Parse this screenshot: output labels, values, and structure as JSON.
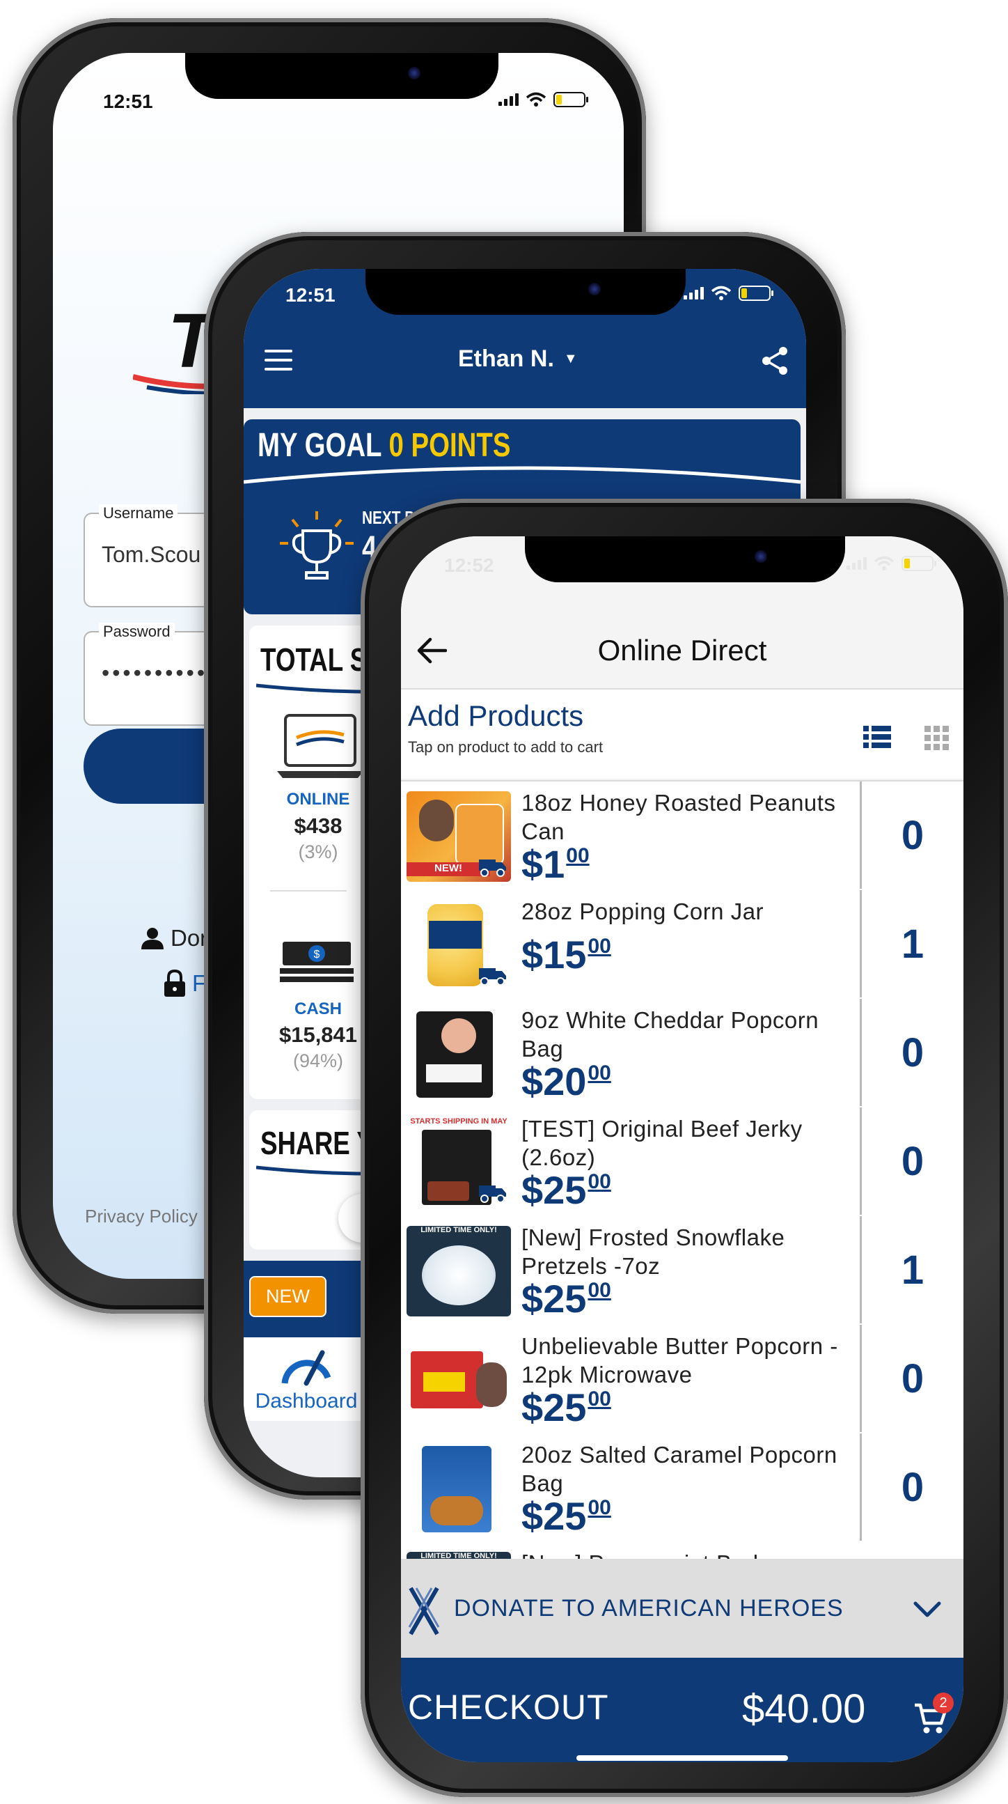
{
  "login": {
    "status_time": "12:51",
    "logo_text": "TR",
    "username_label": "Username",
    "username_value": "Tom.Scou",
    "password_label": "Password",
    "password_value": "••••••••••",
    "donate_link": "Don",
    "forgot_link": "Fo",
    "privacy_link": "Privacy Policy"
  },
  "dashboard": {
    "status_time": "12:51",
    "scout_name": "Ethan N.",
    "goal_title": "MY GOAL",
    "goal_points": "0 POINTS",
    "next_prize_label": "NEXT PR",
    "next_prize_value": "4",
    "total_sales_title": "TOTAL SA",
    "online_label": "ONLINE",
    "online_amount": "$438",
    "online_pct": "(3%)",
    "cash_label": "CASH",
    "cash_amount": "$15,841",
    "cash_pct": "(94%)",
    "share_title": "SHARE YO",
    "new_badge": "NEW",
    "nav_dashboard": "Dashboard"
  },
  "online_direct": {
    "status_time": "12:52",
    "title": "Online Direct",
    "add_products_title": "Add Products",
    "add_products_hint": "Tap on product to add to cart",
    "products": [
      {
        "name": "18oz Honey Roasted Peanuts Can",
        "price_dollars": "$1",
        "price_cents": "00",
        "qty": "0",
        "shipping": true,
        "img_badge": "NEW!"
      },
      {
        "name": "28oz Popping Corn Jar",
        "price_dollars": "$15",
        "price_cents": "00",
        "qty": "1",
        "shipping": true,
        "img_badge": ""
      },
      {
        "name": " 9oz White Cheddar Popcorn Bag",
        "price_dollars": "$20",
        "price_cents": "00",
        "qty": "0",
        "shipping": false,
        "img_badge": ""
      },
      {
        "name": "[TEST] Original Beef Jerky (2.6oz)",
        "price_dollars": "$25",
        "price_cents": "00",
        "qty": "0",
        "shipping": true,
        "img_badge": "STARTS SHIPPING IN MAY"
      },
      {
        "name": "[New] Frosted Snowflake Pretzels -7oz",
        "price_dollars": "$25",
        "price_cents": "00",
        "qty": "1",
        "shipping": false,
        "img_badge": "LIMITED TIME ONLY!"
      },
      {
        "name": "Unbelievable Butter Popcorn - 12pk Microwave",
        "price_dollars": "$25",
        "price_cents": "00",
        "qty": "0",
        "shipping": false,
        "img_badge": ""
      },
      {
        "name": "20oz Salted Caramel Popcorn Bag",
        "price_dollars": "$25",
        "price_cents": "00",
        "qty": "0",
        "shipping": false,
        "img_badge": ""
      },
      {
        "name": "[New] Peppermint Bark",
        "price_dollars": "",
        "price_cents": "",
        "qty": "",
        "shipping": false,
        "img_badge": "LIMITED TIME ONLY!"
      }
    ],
    "donate_label": "DONATE TO AMERICAN HEROES",
    "checkout_label": "CHECKOUT",
    "checkout_total": "$40.00",
    "cart_count": "2"
  },
  "colors": {
    "navy": "#0f3a78",
    "orange": "#f39200",
    "white": "#ffffff",
    "cart_badge": "#e53935"
  }
}
